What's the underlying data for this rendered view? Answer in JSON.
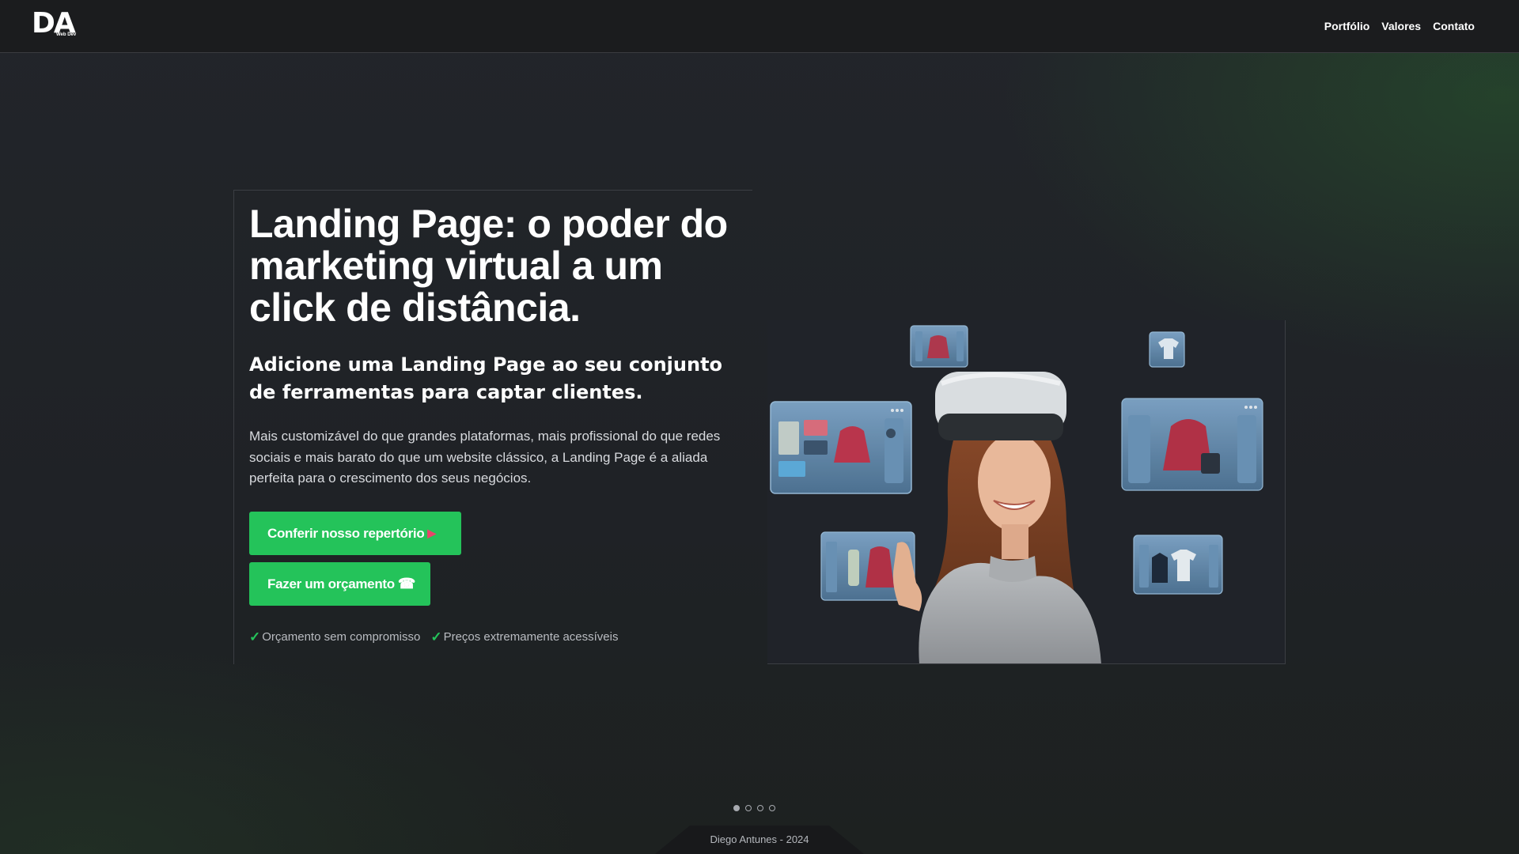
{
  "navbar": {
    "logo": {
      "main": "DA",
      "sub": "Web Dev"
    },
    "links": [
      {
        "label": "Portfólio"
      },
      {
        "label": "Valores"
      },
      {
        "label": "Contato"
      }
    ]
  },
  "hero": {
    "title": "Landing Page: o poder do marketing virtual a um click de distância.",
    "subtitle": "Adicione uma Landing Page ao seu conjunto de ferramentas para captar clientes.",
    "description": "Mais customizável do que grandes plataformas, mais profissional do que redes sociais e mais barato do que um website clássico, a Landing Page é a aliada perfeita para o crescimento dos seus negócios.",
    "buttons": {
      "portfolio_label": "Conferir nosso repertório",
      "quote_label": "Fazer um orçamento"
    },
    "checks": [
      {
        "label": "Orçamento sem compromisso"
      },
      {
        "label": "Preços extremamente acessíveis"
      }
    ],
    "image_alt": "Woman with VR headset interacting with floating shopping panels"
  },
  "carousel": {
    "slides": 4,
    "active": 1
  },
  "footer": {
    "text": "Diego Antunes - 2024"
  },
  "colors": {
    "accent": "#24c35a",
    "background": "#1e2024",
    "navbar": "#1b1c1e",
    "play_icon": "#e8456a"
  },
  "icons": {
    "play": "play-icon",
    "phone": "phone-icon",
    "check": "check-icon"
  }
}
